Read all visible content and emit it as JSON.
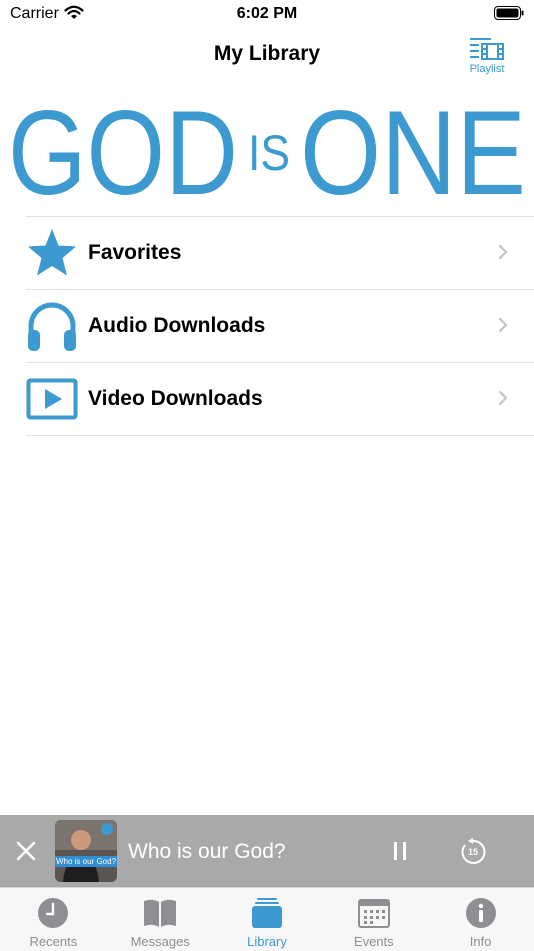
{
  "status_bar": {
    "carrier": "Carrier",
    "time": "6:02 PM"
  },
  "nav": {
    "title": "My Library",
    "playlist_label": "Playlist"
  },
  "logo": {
    "god": "GOD",
    "is": "IS",
    "one": "ONE",
    "color": "#3c9ad0"
  },
  "menu": [
    {
      "label": "Favorites",
      "icon": "star-icon"
    },
    {
      "label": "Audio Downloads",
      "icon": "headphones-icon"
    },
    {
      "label": "Video Downloads",
      "icon": "video-play-icon"
    }
  ],
  "player": {
    "title": "Who is our God?",
    "thumb_caption": "Who is our God?",
    "skip_seconds": "15"
  },
  "tabs": [
    {
      "label": "Recents",
      "icon": "clock-icon",
      "active": false
    },
    {
      "label": "Messages",
      "icon": "book-icon",
      "active": false
    },
    {
      "label": "Library",
      "icon": "library-stack-icon",
      "active": true
    },
    {
      "label": "Events",
      "icon": "calendar-icon",
      "active": false
    },
    {
      "label": "Info",
      "icon": "info-icon",
      "active": false
    }
  ],
  "colors": {
    "accent": "#3c9ad0",
    "player_bg": "#a9a9a9",
    "inactive": "#8e8e93"
  }
}
